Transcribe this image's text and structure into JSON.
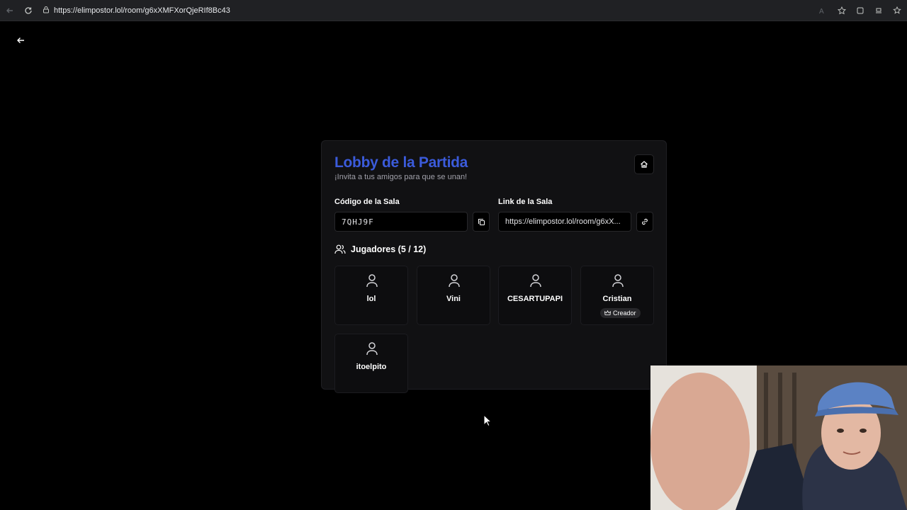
{
  "browser": {
    "url": "https://elimpostor.lol/room/g6xXMFXorQjeRIf8Bc43"
  },
  "lobby": {
    "title": "Lobby de la Partida",
    "subtitle": "¡Invita a tus amigos para que se unan!",
    "room_code_label": "Código de la Sala",
    "room_code": "7QHJ9F",
    "room_link_label": "Link de la Sala",
    "room_link": "https://elimpostor.lol/room/g6xX...",
    "players_heading": "Jugadores (5 / 12)",
    "players": [
      {
        "name": "lol"
      },
      {
        "name": "Vini"
      },
      {
        "name": "CESARTUPAPI"
      },
      {
        "name": "Cristian",
        "badge": "Creador"
      },
      {
        "name": "itoelpito"
      }
    ]
  },
  "colors": {
    "accent": "#3b5bdb",
    "background": "#000000",
    "card": "#111113"
  }
}
